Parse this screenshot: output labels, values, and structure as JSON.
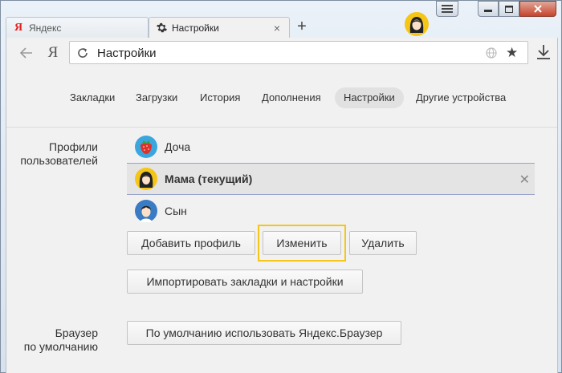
{
  "tabs": [
    {
      "title": "Яндекс",
      "favicon": "yandex-logo-icon",
      "active": false
    },
    {
      "title": "Настройки",
      "favicon": "gear-icon",
      "active": true
    }
  ],
  "toolbar": {
    "ya_button": "Я",
    "address_text": "Настройки"
  },
  "nav": {
    "items": [
      "Закладки",
      "Загрузки",
      "История",
      "Дополнения",
      "Настройки",
      "Другие устройства"
    ],
    "active": "Настройки"
  },
  "profiles_section": {
    "label_line1": "Профили",
    "label_line2": "пользователей",
    "profiles": [
      {
        "name": "Доча",
        "avatar": "strawberry-avatar-icon"
      },
      {
        "name": "Мама (текущий)",
        "avatar": "girl-avatar-icon",
        "current": true
      },
      {
        "name": "Сын",
        "avatar": "boy-avatar-icon"
      }
    ],
    "buttons": {
      "add": "Добавить профиль",
      "edit": "Изменить",
      "delete": "Удалить",
      "import": "Импортировать закладки и настройки"
    }
  },
  "default_browser_section": {
    "label_line1": "Браузер",
    "label_line2": "по умолчанию",
    "button": "По умолчанию использовать Яндекс.Браузер"
  },
  "colors": {
    "focus_ring": "#f5c518",
    "close_button": "#c7432c",
    "current_row": "#e4e4e4"
  }
}
